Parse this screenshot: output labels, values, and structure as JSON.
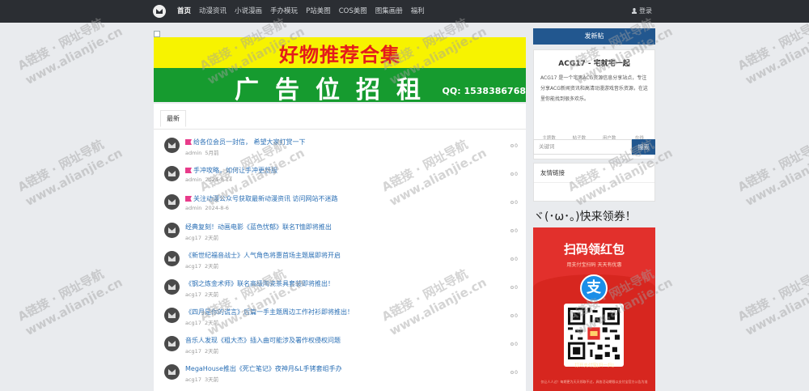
{
  "nav": {
    "items": [
      "首页",
      "动漫资讯",
      "小说漫画",
      "手办模玩",
      "P站美图",
      "COS美图",
      "图集画册",
      "福利"
    ],
    "login": "登录"
  },
  "banner": {
    "top_text": "好物推荐合集",
    "main_text": "广告位招租",
    "qq": "QQ: 1538386768"
  },
  "tabs": [
    "最新"
  ],
  "topics": [
    {
      "title": "给各位会员一封信， 希望大家打赏一下",
      "author": "admin",
      "time": "5月前",
      "count": "0",
      "pinned": true
    },
    {
      "title": "手冲攻略，如何让手冲更舒服",
      "author": "admin",
      "time": "2024-8-14",
      "count": "0",
      "pinned": true
    },
    {
      "title": "关注动漫公众号获取最新动漫资讯 访问网站不迷路",
      "author": "admin",
      "time": "2024-8-6",
      "count": "0",
      "pinned": true
    },
    {
      "title": "经典复刻！动画电影《蓝色忧郁》联名T恤即将推出",
      "author": "acg17",
      "time": "2天前",
      "count": "0",
      "pinned": false
    },
    {
      "title": "《新世纪福音战士》人气角色将惠首场主题展即将开启",
      "author": "acg17",
      "time": "2天前",
      "count": "0",
      "pinned": false
    },
    {
      "title": "《钢之炼金术师》联名高级陶瓷茶具套装即将推出！",
      "author": "acg17",
      "time": "2天前",
      "count": "0",
      "pinned": false
    },
    {
      "title": "《四月是你的谎言》后篇一手主题周边工作衬衫即将推出！",
      "author": "acg17",
      "time": "2天前",
      "count": "0",
      "pinned": false
    },
    {
      "title": "音乐人发现《粗大杰》插入曲可能涉及署作权侵权问题",
      "author": "acg17",
      "time": "2天前",
      "count": "0",
      "pinned": false
    },
    {
      "title": "MegaHouse推出《死亡笔记》夜神月&L手铐套组手办",
      "author": "acg17",
      "time": "3天前",
      "count": "0",
      "pinned": false
    }
  ],
  "sidebar": {
    "post_button": "发新帖",
    "site_title": "ACG17 - 宅就宅一起",
    "site_desc": "ACG17 是一个宅男ACG资源信息分享站点，专注分享ACG新闻资讯和高清动漫游戏音乐资源，在这里你能找到很多欢乐。",
    "stats": [
      {
        "label": "主题数",
        "value": "5455"
      },
      {
        "label": "帖子数",
        "value": "1"
      },
      {
        "label": "用户数",
        "value": "95"
      },
      {
        "label": "在线",
        "value": "1"
      }
    ],
    "search_placeholder": "关键词",
    "search_button": "搜索",
    "links_title": "友情链接",
    "promo_title": "ヾ(･ω･｡)快来领券！",
    "promo_heading": "扫码领红包",
    "promo_sub": "用支付宝扫码  天天有优惠",
    "promo_logo": "支",
    "promo_caption": "打开支付宝[扫一扫]",
    "promo_fine": "仅让人人过！每期更为天天领取不过，具各活动期限以支付宝官方公告为准"
  },
  "watermark": {
    "line1": "A链接 · 网址导航",
    "line2": "www.alianjie.cn"
  }
}
